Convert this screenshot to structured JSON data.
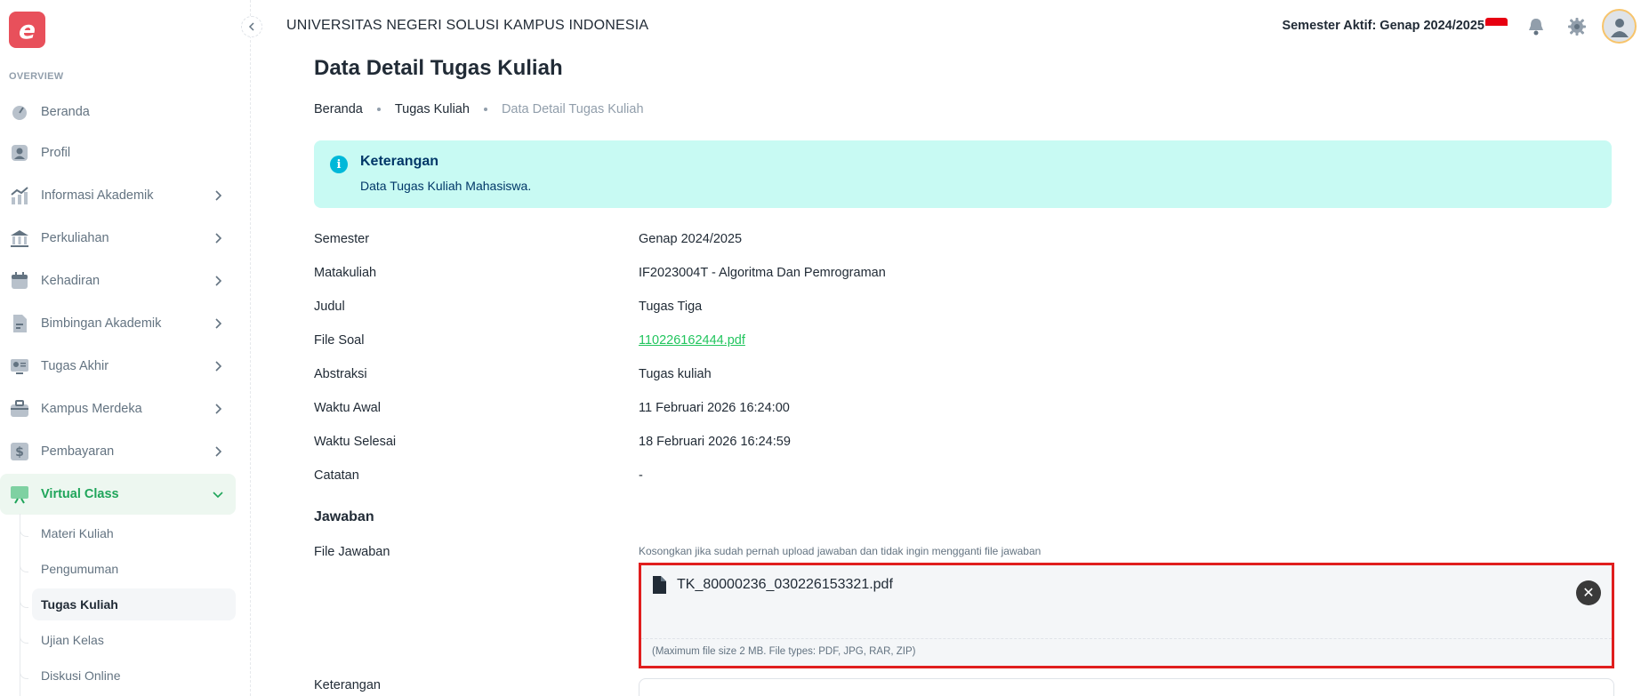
{
  "app": {
    "logo_letter": "e",
    "university_name": "UNIVERSITAS NEGERI SOLUSI KAMPUS INDONESIA",
    "semester_label": "Semester Aktif: Genap 2024/2025"
  },
  "sidebar": {
    "subheader": "OVERVIEW",
    "items": [
      {
        "label": "Beranda",
        "icon": "dashboard-icon"
      },
      {
        "label": "Profil",
        "icon": "user-icon"
      },
      {
        "label": "Informasi Akademik",
        "icon": "chart-icon"
      },
      {
        "label": "Perkuliahan",
        "icon": "bank-icon"
      },
      {
        "label": "Kehadiran",
        "icon": "calendar-icon"
      },
      {
        "label": "Bimbingan Akademik",
        "icon": "document-icon"
      },
      {
        "label": "Tugas Akhir",
        "icon": "thesis-icon"
      },
      {
        "label": "Kampus Merdeka",
        "icon": "briefcase-icon"
      },
      {
        "label": "Pembayaran",
        "icon": "payment-icon"
      },
      {
        "label": "Virtual Class",
        "icon": "board-icon"
      }
    ],
    "sub_items": [
      {
        "label": "Materi Kuliah"
      },
      {
        "label": "Pengumuman"
      },
      {
        "label": "Tugas Kuliah"
      },
      {
        "label": "Ujian Kelas"
      },
      {
        "label": "Diskusi Online"
      }
    ]
  },
  "page": {
    "title": "Data Detail Tugas Kuliah",
    "breadcrumb": [
      "Beranda",
      "Tugas Kuliah",
      "Data Detail Tugas Kuliah"
    ]
  },
  "alert": {
    "title": "Keterangan",
    "text": "Data Tugas Kuliah Mahasiswa."
  },
  "details": [
    {
      "label": "Semester",
      "value": "Genap 2024/2025"
    },
    {
      "label": "Matakuliah",
      "value": "IF2023004T - Algoritma Dan Pemrograman"
    },
    {
      "label": "Judul",
      "value": "Tugas Tiga"
    },
    {
      "label": "File Soal",
      "value": "110226162444.pdf"
    },
    {
      "label": "Abstraksi",
      "value": "Tugas kuliah"
    },
    {
      "label": "Waktu Awal",
      "value": "11 Februari 2026 16:24:00"
    },
    {
      "label": "Waktu Selesai",
      "value": "18 Februari 2026 16:24:59"
    },
    {
      "label": "Catatan",
      "value": "-"
    }
  ],
  "answer": {
    "section_title": "Jawaban",
    "file_label": "File Jawaban",
    "hint": "Kosongkan jika sudah pernah upload jawaban dan tidak ingin mengganti file jawaban",
    "file_name": "TK_80000236_030226153321.pdf",
    "max_note": "(Maximum file size 2 MB. File types: PDF, JPG, RAR, ZIP)",
    "remove_symbol": "✕",
    "keterangan_label": "Keterangan"
  },
  "colors": {
    "accent": "#1fa55a",
    "alert_bg": "#c8faf3",
    "highlight_border": "#e01e1e",
    "link": "#22c55e"
  }
}
